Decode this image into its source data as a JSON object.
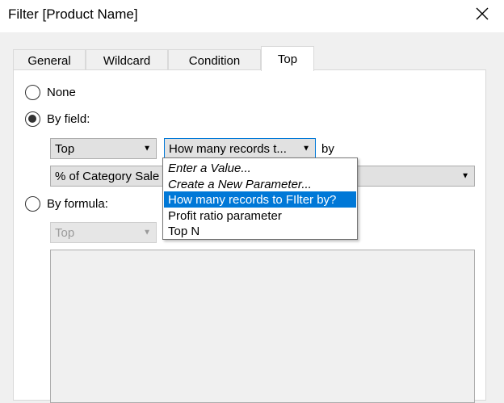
{
  "window": {
    "title": "Filter [Product Name]"
  },
  "tabs": [
    {
      "label": "General"
    },
    {
      "label": "Wildcard"
    },
    {
      "label": "Condition"
    },
    {
      "label": "Top"
    }
  ],
  "options": {
    "none_label": "None",
    "by_field_label": "By field:",
    "by_formula_label": "By formula:",
    "selected": "By field:"
  },
  "by_field": {
    "top_bottom_value": "Top",
    "count_value": "How many records t...",
    "by_label": "by",
    "field_value": "% of Category Sale"
  },
  "count_dropdown": {
    "items": [
      {
        "label": "Enter a Value..."
      },
      {
        "label": "Create a New Parameter..."
      },
      {
        "label": "How many records to FIlter by?"
      },
      {
        "label": "Profit ratio parameter"
      },
      {
        "label": "Top N"
      }
    ],
    "selected": "How many records to FIlter by?"
  },
  "by_formula": {
    "top_bottom_value": "Top"
  }
}
